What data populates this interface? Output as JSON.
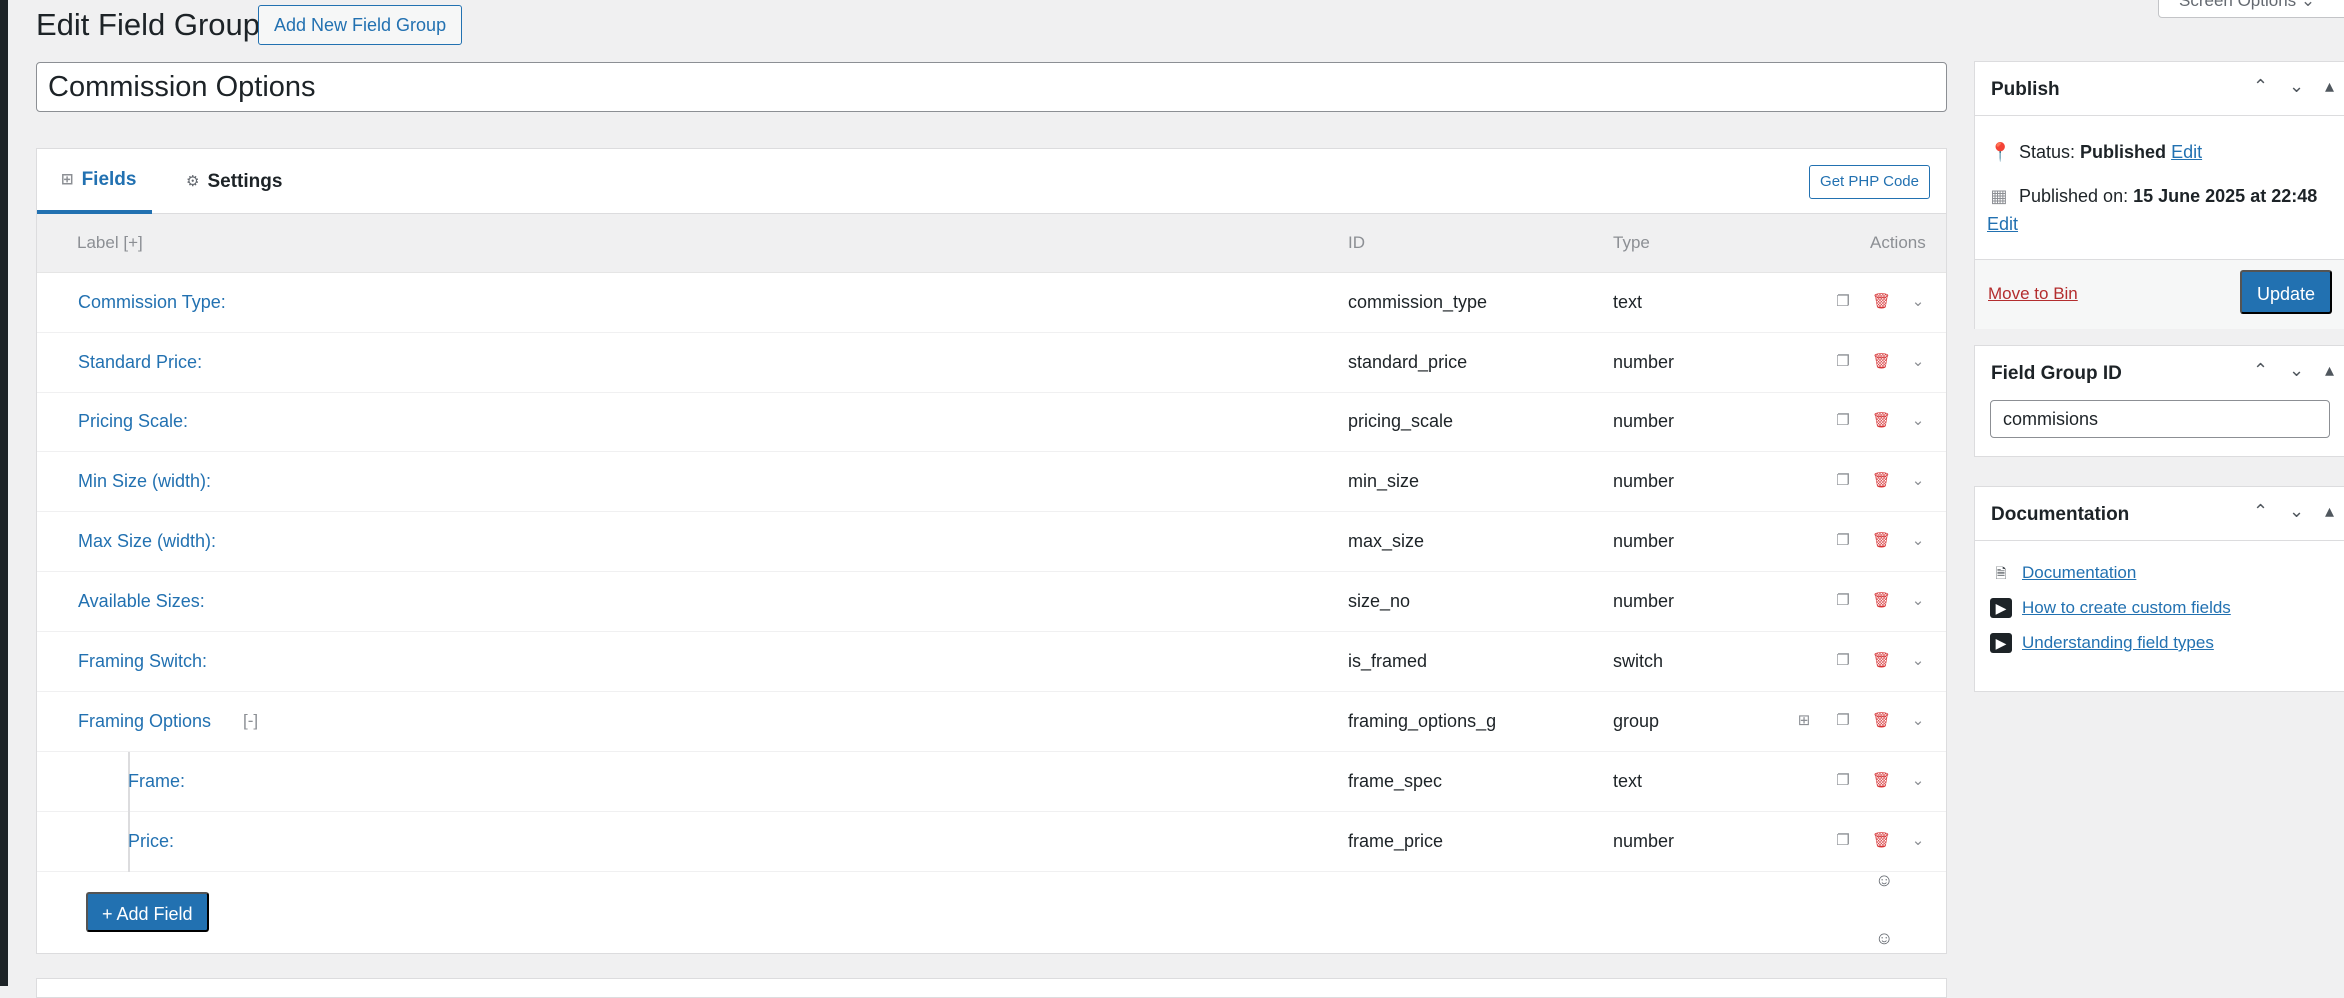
{
  "header": {
    "title": "Edit Field Group",
    "add_new_label": "Add New Field Group",
    "screen_options_label": "Screen Options"
  },
  "title_input": {
    "value": "Commission Options"
  },
  "tabs": [
    {
      "label": "Fields",
      "icon": "grid-icon"
    },
    {
      "label": "Settings",
      "icon": "gear-icon"
    }
  ],
  "php_button": "Get PHP Code",
  "table_header": {
    "label": "Label",
    "label_toggle": "[+]",
    "id": "ID",
    "type": "Type",
    "actions": "Actions"
  },
  "rows": [
    {
      "label": "Commission Type:",
      "id": "commission_type",
      "type": "text"
    },
    {
      "label": "Standard Price:",
      "id": "standard_price",
      "type": "number"
    },
    {
      "label": "Pricing Scale:",
      "id": "pricing_scale",
      "type": "number"
    },
    {
      "label": "Min Size (width):",
      "id": "min_size",
      "type": "number"
    },
    {
      "label": "Max Size (width):",
      "id": "max_size",
      "type": "number"
    },
    {
      "label": "Available Sizes:",
      "id": "size_no",
      "type": "number"
    },
    {
      "label": "Framing Switch:",
      "id": "is_framed",
      "type": "switch"
    },
    {
      "label": "Framing Options",
      "id": "framing_options_g",
      "type": "group",
      "toggle": "[-]"
    },
    {
      "label": "Frame:",
      "id": "frame_spec",
      "type": "text"
    },
    {
      "label": "Price:",
      "id": "frame_price",
      "type": "number"
    }
  ],
  "add_field_label": "+ Add Field",
  "publish": {
    "title": "Publish",
    "status_prefix": "Status:",
    "status_value": "Published",
    "edit_label": "Edit",
    "published_on_prefix": "Published on:",
    "published_on_value": "15 June 2025 at 22:48",
    "move_to_bin": "Move to Bin",
    "update_label": "Update"
  },
  "field_group_id": {
    "title": "Field Group ID",
    "value": "commisions"
  },
  "documentation": {
    "title": "Documentation",
    "links": [
      {
        "label": "Documentation",
        "icon": "document-icon"
      },
      {
        "label": "How to create custom fields",
        "icon": "play-icon"
      },
      {
        "label": "Understanding field types",
        "icon": "play-icon"
      }
    ]
  },
  "colors": {
    "accent": "#2271b1",
    "danger": "#d63638",
    "background": "#f0f0f1"
  }
}
